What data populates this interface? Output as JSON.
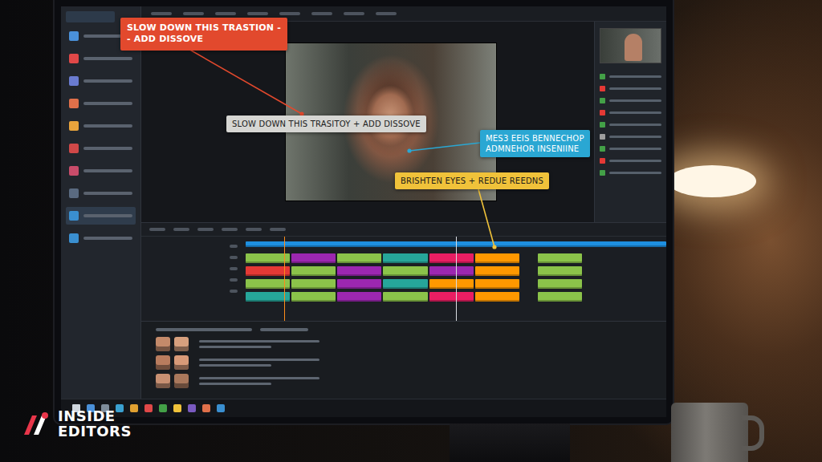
{
  "brand": {
    "logo_lines": [
      "INSIDE",
      "EDITORS"
    ]
  },
  "annotations": [
    {
      "text": "SLOW DOWN THIS TRASTION -\n- ADD DISSOVE",
      "color": "#e2492d"
    },
    {
      "text": "SLOW DOWN THIS TRASITOY + ADD DISSOVE",
      "color": "#d6d6d3"
    },
    {
      "text": "MES3 EEIS BENNECHOP\nADMNEHOR INSENIINE",
      "color": "#2aa7d3"
    },
    {
      "text": "BRISHTEN EYES + REDUE REEDNS",
      "color": "#f0c23a"
    }
  ],
  "sidebar": {
    "items": [
      {
        "color": "#4a90d9",
        "selected": false
      },
      {
        "color": "#e04848",
        "selected": false
      },
      {
        "color": "#6a7bd0",
        "selected": false
      },
      {
        "color": "#e0704a",
        "selected": false
      },
      {
        "color": "#e8a33c",
        "selected": false
      },
      {
        "color": "#d04848",
        "selected": false
      },
      {
        "color": "#c94c6a",
        "selected": false
      },
      {
        "color": "#5a6a80",
        "selected": false
      },
      {
        "color": "#3a8fd0",
        "selected": true
      },
      {
        "color": "#3a8fd0",
        "selected": false
      }
    ]
  },
  "inspector": {
    "rows": [
      {
        "color": "#43a047"
      },
      {
        "color": "#e53935"
      },
      {
        "color": "#43a047"
      },
      {
        "color": "#e53935"
      },
      {
        "color": "#43a047"
      },
      {
        "color": "#9e9e9e"
      },
      {
        "color": "#43a047"
      },
      {
        "color": "#e53935"
      },
      {
        "color": "#43a047"
      }
    ]
  },
  "timeline": {
    "tracks": [
      {
        "kind": "master",
        "clips": [
          {
            "kind": "clip",
            "color": "#1e8fe0"
          }
        ]
      },
      {
        "kind": "video",
        "clips": [
          {
            "kind": "clip",
            "color": "#8bc34a"
          },
          {
            "kind": "clip",
            "color": "#9c27b0"
          },
          {
            "kind": "clip",
            "color": "#8bc34a"
          },
          {
            "kind": "clip",
            "color": "#26a69a"
          },
          {
            "kind": "clip",
            "color": "#e91e63"
          },
          {
            "kind": "clip",
            "color": "#ff9800"
          },
          {
            "kind": "gap"
          },
          {
            "kind": "clip",
            "color": "#8bc34a"
          }
        ]
      },
      {
        "kind": "video",
        "clips": [
          {
            "kind": "clip",
            "color": "#e53935"
          },
          {
            "kind": "clip",
            "color": "#8bc34a"
          },
          {
            "kind": "clip",
            "color": "#9c27b0"
          },
          {
            "kind": "clip",
            "color": "#8bc34a"
          },
          {
            "kind": "clip",
            "color": "#9c27b0"
          },
          {
            "kind": "clip",
            "color": "#ff9800"
          },
          {
            "kind": "gap"
          },
          {
            "kind": "clip",
            "color": "#8bc34a"
          }
        ]
      },
      {
        "kind": "video",
        "clips": [
          {
            "kind": "clip",
            "color": "#8bc34a"
          },
          {
            "kind": "clip",
            "color": "#8bc34a"
          },
          {
            "kind": "clip",
            "color": "#9c27b0"
          },
          {
            "kind": "clip",
            "color": "#26a69a"
          },
          {
            "kind": "clip",
            "color": "#ff9800"
          },
          {
            "kind": "clip",
            "color": "#ff9800"
          },
          {
            "kind": "gap"
          },
          {
            "kind": "clip",
            "color": "#8bc34a"
          }
        ]
      },
      {
        "kind": "video",
        "clips": [
          {
            "kind": "clip",
            "color": "#26a69a"
          },
          {
            "kind": "clip",
            "color": "#8bc34a"
          },
          {
            "kind": "clip",
            "color": "#9c27b0"
          },
          {
            "kind": "clip",
            "color": "#8bc34a"
          },
          {
            "kind": "clip",
            "color": "#e91e63"
          },
          {
            "kind": "clip",
            "color": "#ff9800"
          },
          {
            "kind": "gap"
          },
          {
            "kind": "clip",
            "color": "#8bc34a"
          }
        ]
      }
    ]
  },
  "comments": [
    {
      "avatars": [
        {
          "color": "#c48a6a"
        },
        {
          "color": "#d7a07e"
        }
      ]
    },
    {
      "avatars": [
        {
          "color": "#b97c5e"
        },
        {
          "color": "#d89a78"
        }
      ]
    },
    {
      "avatars": [
        {
          "color": "#c89072"
        },
        {
          "color": "#a9785c"
        }
      ]
    }
  ],
  "taskbar": {
    "icons": [
      {
        "color": "#4a90d9"
      },
      {
        "color": "#7e8c9a"
      },
      {
        "color": "#3aa0d0"
      },
      {
        "color": "#e0a030"
      },
      {
        "color": "#e04848"
      },
      {
        "color": "#43a047"
      },
      {
        "color": "#f0c23a"
      },
      {
        "color": "#7a5ac0"
      },
      {
        "color": "#e0704a"
      },
      {
        "color": "#3a8fd0"
      }
    ]
  }
}
